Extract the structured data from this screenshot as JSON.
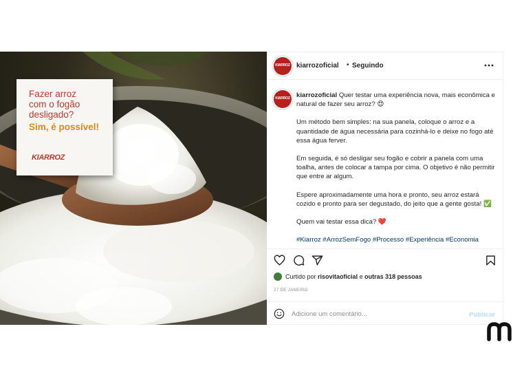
{
  "image_card": {
    "lines": [
      "Fazer arroz",
      "com o fogão",
      "desligado?"
    ],
    "highlight": "Sim, é possível!",
    "logo": "KIARROZ"
  },
  "post": {
    "avatar_text": "KIARROZ",
    "username": "kiarrozoficial",
    "separator": "•",
    "follow_status": "Seguindo",
    "more_icon": "more-horizontal-icon",
    "caption": {
      "username": "kiarrozoficial",
      "intro": "Quer testar uma experiência nova, mais econômica e natural de fazer seu arroz?",
      "intro_emoji": "😍",
      "paragraphs": [
        "Um método bem simples: na sua panela, coloque o arroz e a quantidade de água necessária para cozinhá-lo e deixe no fogo até essa água ferver.",
        "Em seguida, é só desligar seu fogão e cobrir a panela com uma toalha, antes de colocar a tampa por cima. O objetivo é não permitir que entre ar algum.",
        "Espere aproximadamente uma hora e pronto, seu arroz estará cozido e pronto para ser degustado, do jeito que a gente gosta!"
      ],
      "check_emoji": "✅",
      "question": "Quem vai testar essa dica?",
      "heart_emoji": "❤️",
      "hashtags": "#Kiarroz #ArrozSemFogo #Processo #Experiência #Economia"
    },
    "likes": {
      "prefix": "Curtido por",
      "user": "risovitaoficial",
      "middle": "e",
      "others": "outras 318 pessoas"
    },
    "date": "27 DE JANEIRO",
    "comment": {
      "placeholder": "Adicione um comentário...",
      "publish_label": "Publicar"
    },
    "colors": {
      "brand_red": "#b8201d",
      "link_blue": "#00376b",
      "publish_disabled": "#b2dffc"
    }
  }
}
